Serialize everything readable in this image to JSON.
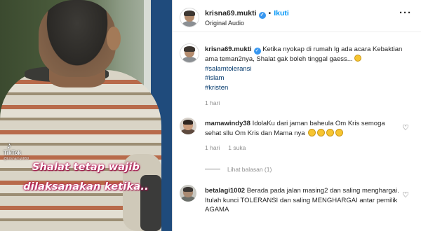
{
  "video": {
    "watermark": {
      "brand": "TikTok",
      "handle": "@krisnamukti69"
    },
    "caption_lines": [
      "Shalat tetap wajib",
      "dilaksanakan ketika.."
    ]
  },
  "header": {
    "username": "krisna69.mukti",
    "verified": true,
    "separator": "•",
    "follow_label": "Ikuti",
    "audio": "Original Audio",
    "more_icon": "more-horizontal-icon"
  },
  "post": {
    "username": "krisna69.mukti",
    "verified": true,
    "text": "Ketika nyokap di rumah lg ada acara Kebaktian ama teman2nya, Shalat gak boleh tinggal gaess...",
    "hashtags": [
      "#salamtoleransi",
      "#islam",
      "#kristen"
    ],
    "time": "1 hari"
  },
  "comments": [
    {
      "username": "mamawindy38",
      "text": "IdolaKu dari jaman baheula Om Kris semoga sehat sllu Om Kris dan Mama nya",
      "time": "1 hari",
      "likes": "1 suka",
      "emoji_count": 4
    },
    {
      "username": "betalagi1002",
      "text": "Berada pada jalan masing2 dan saling menghargai. Itulah kunci TOLERANSI dan saling MENGHARGAI antar pemilik AGAMA"
    }
  ],
  "replies_label": "Lihat balasan (1)",
  "colors": {
    "link_blue": "#0095f6",
    "hashtag_blue": "#00376b",
    "verified_blue": "#3897f0",
    "meta_gray": "#8e8e8e",
    "caption_glow": "#c2185b"
  }
}
